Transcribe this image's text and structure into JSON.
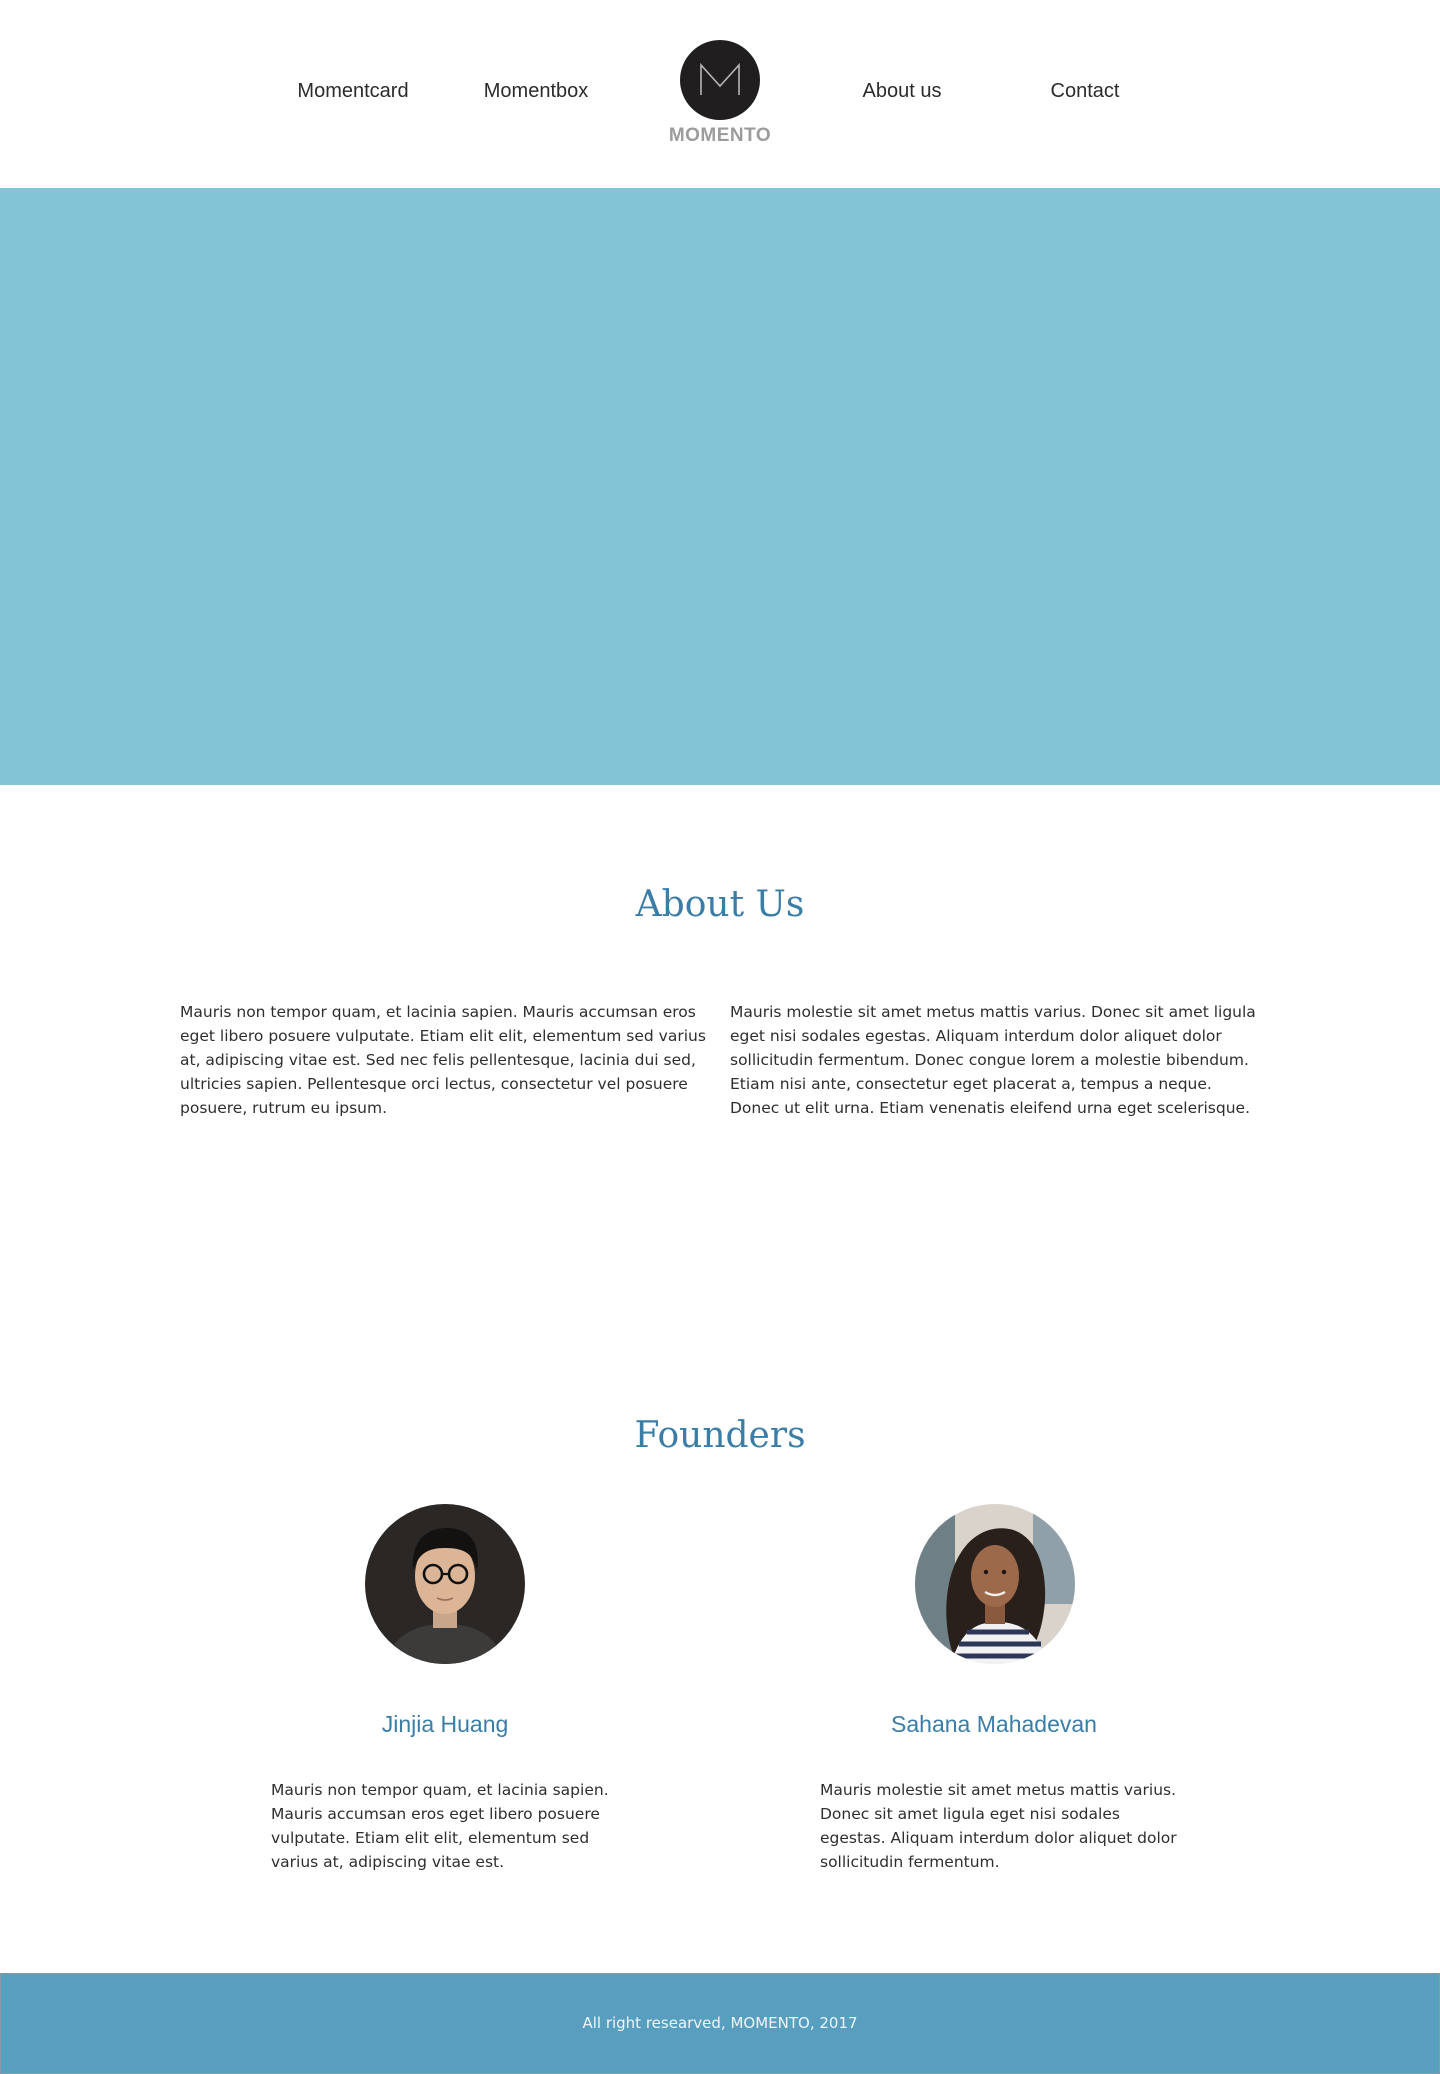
{
  "nav": {
    "items": [
      {
        "label": "Momentcard"
      },
      {
        "label": "Momentbox"
      },
      {
        "label": "About us"
      },
      {
        "label": "Contact"
      }
    ],
    "logo_text": "MOMENTO"
  },
  "hero": {
    "color": "#83c4d7"
  },
  "about": {
    "title": "About Us",
    "paragraphs": [
      "Mauris non tempor quam, et lacinia sapien. Mauris accumsan eros eget libero posuere vulputate. Etiam elit elit, elementum sed varius at, adipiscing vitae est. Sed nec felis pellentesque, lacinia dui sed, ultricies sapien. Pellentesque orci lectus, consectetur vel posuere posuere, rutrum eu ipsum.",
      "Mauris molestie sit amet metus mattis varius. Donec sit amet ligula eget nisi sodales egestas. Aliquam interdum dolor aliquet dolor sollicitudin fermentum. Donec congue lorem a molestie bibendum. Etiam nisi ante, consectetur eget placerat a, tempus a neque. Donec ut elit urna. Etiam venenatis eleifend urna eget scelerisque."
    ]
  },
  "founders": {
    "title": "Founders",
    "people": [
      {
        "name": "Jinjia Huang",
        "bio": "Mauris non tempor quam, et lacinia sapien. Mauris accumsan eros eget libero posuere vulputate. Etiam elit elit, elementum sed varius at, adipiscing vitae est."
      },
      {
        "name": "Sahana Mahadevan",
        "bio": "Mauris molestie sit amet metus mattis varius. Donec sit amet ligula eget nisi sodales egestas. Aliquam interdum dolor aliquet dolor sollicitudin fermentum."
      }
    ]
  },
  "footer": {
    "text": "All right researved, MOMENTO, 2017",
    "color": "#579ebf"
  },
  "colors": {
    "accent": "#3a7ea8",
    "logo_bg": "#201e1e"
  }
}
